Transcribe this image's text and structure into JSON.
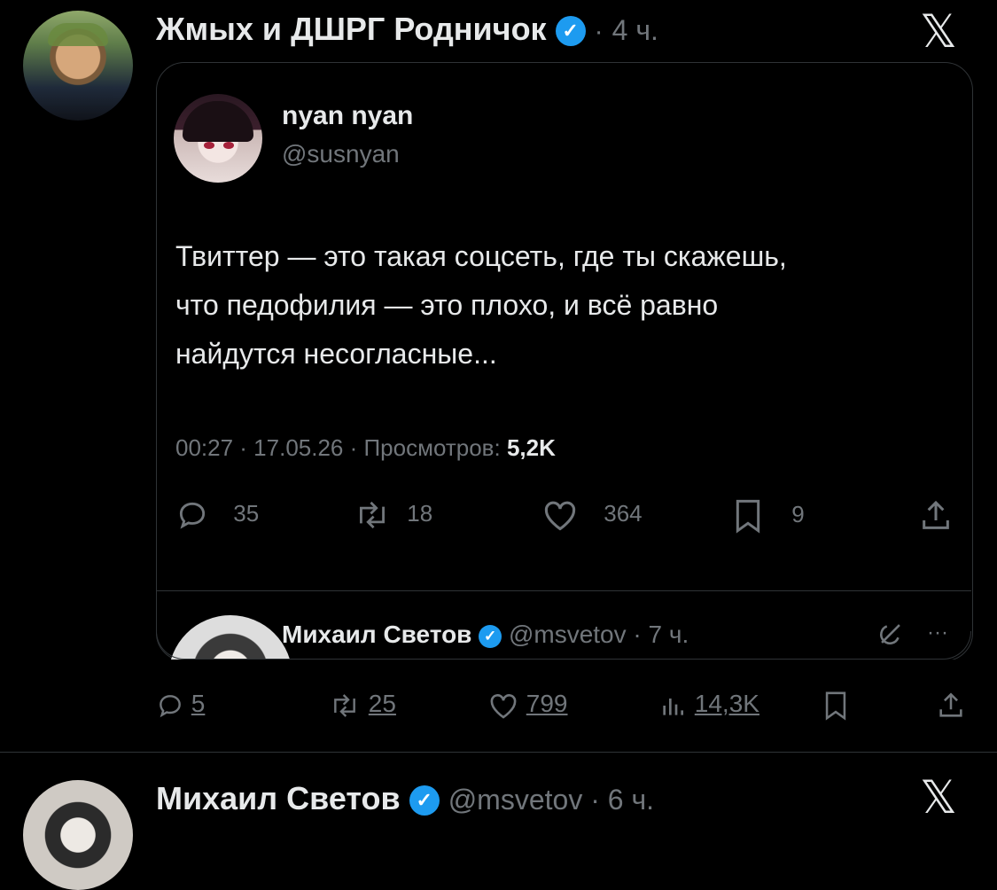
{
  "post": {
    "author_name": "Жмых и ДШРГ Родничок",
    "separator": "·",
    "time": "4 ч.",
    "x_glyph": "𝕏"
  },
  "quote": {
    "author_name": "nyan nyan",
    "handle": "@susnyan",
    "text_lines": [
      "Твиттер — это такая соцсеть, где ты скажешь,",
      "что педофилия — это плохо, и всё равно",
      "найдутся несогласные..."
    ],
    "meta_prefix": "00:27 · 17.05.26 · Просмотров:",
    "views": "5,2K",
    "actions": {
      "replies": "35",
      "reposts": "18",
      "likes": "364",
      "bookmarks": "9"
    },
    "reply": {
      "author_name": "Михаил Светов",
      "handle_time": "@msvetov · 7 ч.",
      "more": "···"
    }
  },
  "post_actions": {
    "replies": "5",
    "reposts": "25",
    "likes": "799",
    "views": "14,3K"
  },
  "next_post": {
    "author_name": "Михаил Светов",
    "handle_time": "@msvetov · 6 ч.",
    "x_glyph": "𝕏"
  },
  "colors": {
    "background": "#000000",
    "text": "#e7e9ea",
    "muted": "#71767b",
    "verified": "#1d9bf0",
    "border": "#2f3336"
  },
  "icons": [
    "verified-icon",
    "x-logo-icon",
    "reply-icon",
    "repost-icon",
    "like-icon",
    "bookmark-icon",
    "share-icon",
    "views-icon",
    "grok-icon",
    "more-icon"
  ]
}
